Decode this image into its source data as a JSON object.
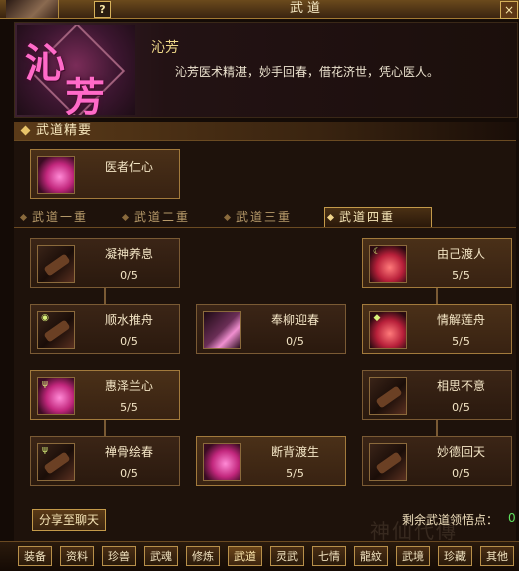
{
  "window": {
    "title": "武道",
    "help_label": "?",
    "close_label": "×"
  },
  "header": {
    "emblem_chars": [
      "沁",
      "芳"
    ],
    "name": "沁芳",
    "description": "沁芳医术精湛，妙手回春，借花济世，凭心医人。"
  },
  "section": {
    "title": "武道精要"
  },
  "feature_skill": {
    "name": "医者仁心",
    "icon": "healer-heart-icon"
  },
  "tabs": [
    {
      "label": "武道一重",
      "active": false
    },
    {
      "label": "武道二重",
      "active": false
    },
    {
      "label": "武道三重",
      "active": false
    },
    {
      "label": "武道四重",
      "active": true
    }
  ],
  "skills": [
    {
      "name": "凝神养息",
      "level": "0/5",
      "icon": "dark-scroll-icon"
    },
    {
      "name": "由己渡人",
      "level": "5/5",
      "icon": "red-swirl-icon"
    },
    {
      "name": "顺水推舟",
      "level": "0/5",
      "icon": "dark-scroll-icon"
    },
    {
      "name": "奉柳迎春",
      "level": "0/5",
      "icon": "dark-blade-icon"
    },
    {
      "name": "情解莲舟",
      "level": "5/5",
      "icon": "red-swirl-icon"
    },
    {
      "name": "惠泽兰心",
      "level": "5/5",
      "icon": "pink-flower-icon"
    },
    {
      "name": "相思不意",
      "level": "0/5",
      "icon": "dark-blade-icon"
    },
    {
      "name": "禅骨绘春",
      "level": "0/5",
      "icon": "dark-scroll-icon"
    },
    {
      "name": "断背渡生",
      "level": "5/5",
      "icon": "pink-flower-icon"
    },
    {
      "name": "妙德回天",
      "level": "0/5",
      "icon": "dark-blade-icon"
    }
  ],
  "footer": {
    "share_label": "分享至聊天",
    "points_label": "剩余武道领悟点：",
    "points_value": "0",
    "watermark": "神仙代傳"
  },
  "bottom_nav": [
    {
      "label": "装备",
      "active": false
    },
    {
      "label": "资料",
      "active": false
    },
    {
      "label": "珍兽",
      "active": false
    },
    {
      "label": "武魂",
      "active": false
    },
    {
      "label": "修炼",
      "active": false
    },
    {
      "label": "武道",
      "active": true
    },
    {
      "label": "灵武",
      "active": false
    },
    {
      "label": "七情",
      "active": false
    },
    {
      "label": "龍紋",
      "active": false
    },
    {
      "label": "武境",
      "active": false
    },
    {
      "label": "珍藏",
      "active": false
    },
    {
      "label": "其他",
      "active": false
    }
  ],
  "colors": {
    "accent_gold": "#c49a4a",
    "points_green": "#5ee05e",
    "emblem_pink": "#ff6ac8"
  }
}
